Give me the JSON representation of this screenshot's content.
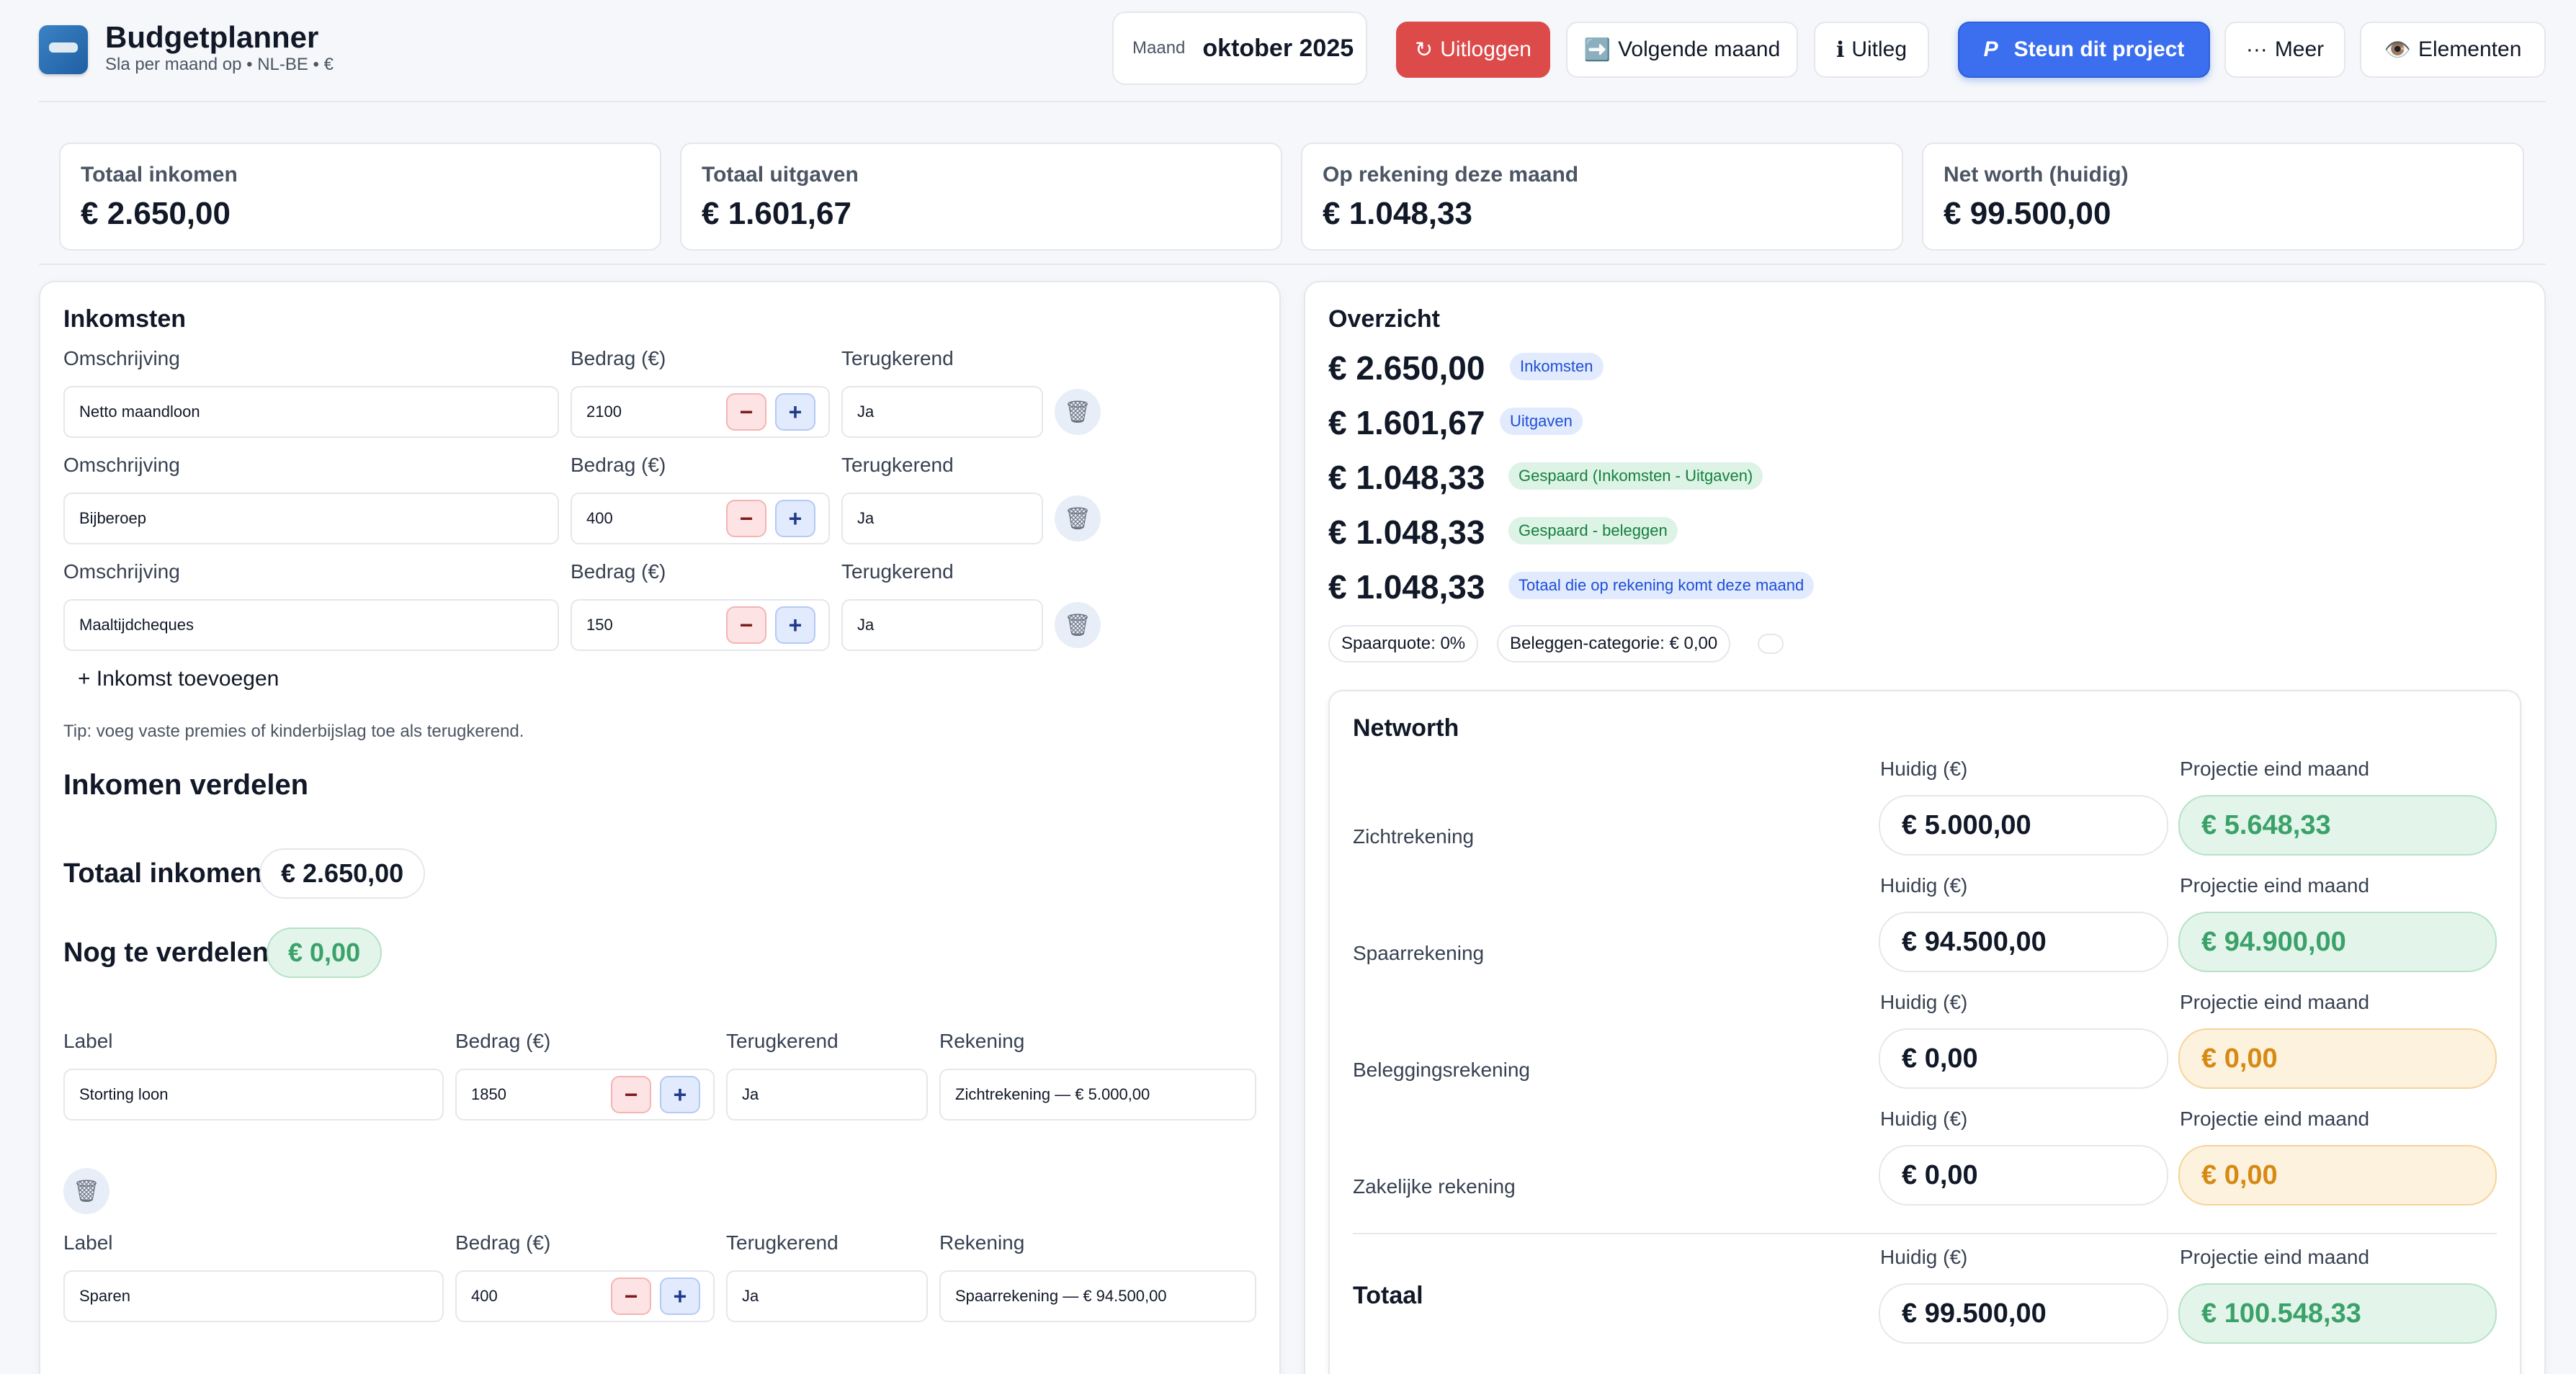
{
  "header": {
    "app_title": "Budgetplanner",
    "app_subtitle": "Sla per maand op • NL-BE • €",
    "month_label": "Maand",
    "month_value": "oktober 2025",
    "logout_label": "Uitloggen",
    "logout_icon": "↻",
    "next_month_label": "Volgende maand",
    "next_month_icon": "➡️",
    "info_label": "Uitleg",
    "info_icon": "ℹ",
    "support_label": "Steun dit project",
    "support_icon": "P",
    "more_label": "Meer",
    "more_icon": "···",
    "elements_label": "Elementen",
    "elements_icon": "👁️",
    "colors": {
      "logout": "#dc4a4a",
      "support": "#3b6ff0"
    }
  },
  "stats": [
    {
      "label": "Totaal inkomen",
      "value": "€ 2.650,00"
    },
    {
      "label": "Totaal uitgaven",
      "value": "€ 1.601,67"
    },
    {
      "label": "Op rekening deze maand",
      "value": "€ 1.048,33"
    },
    {
      "label": "Net worth (huidig)",
      "value": "€ 99.500,00"
    }
  ],
  "income": {
    "title": "Inkomsten",
    "col_description": "Omschrijving",
    "col_amount": "Bedrag (€)",
    "col_recurring": "Terugkerend",
    "rows": [
      {
        "description": "Netto maandloon",
        "amount": "2100",
        "recurring": "Ja"
      },
      {
        "description": "Bijberoep",
        "amount": "400",
        "recurring": "Ja"
      },
      {
        "description": "Maaltijdcheques",
        "amount": "150",
        "recurring": "Ja"
      }
    ],
    "add_label": "+ Inkomst toevoegen",
    "tip": "Tip: voeg vaste premies of kinderbijslag toe als terugkerend."
  },
  "distribute": {
    "title": "Inkomen verdelen",
    "total_label": "Totaal inkomen",
    "total_value": "€ 2.650,00",
    "remaining_label": "Nog te verdelen",
    "remaining_value": "€ 0,00",
    "col_label": "Label",
    "col_amount": "Bedrag (€)",
    "col_recurring": "Terugkerend",
    "col_account": "Rekening",
    "rows": [
      {
        "label": "Storting loon",
        "amount": "1850",
        "recurring": "Ja",
        "account": "Zichtrekening — € 5.000,00"
      },
      {
        "label": "Sparen",
        "amount": "400",
        "recurring": "Ja",
        "account": "Spaarrekening — € 94.500,00"
      }
    ]
  },
  "overview": {
    "title": "Overzicht",
    "items": [
      {
        "amount": "€ 2.650,00",
        "tag": "Inkomsten",
        "tone": "blue"
      },
      {
        "amount": "€ 1.601,67",
        "tag": "Uitgaven",
        "tone": "blue"
      },
      {
        "amount": "€ 1.048,33",
        "tag": "Gespaard (Inkomsten - Uitgaven)",
        "tone": "green"
      },
      {
        "amount": "€ 1.048,33",
        "tag": "Gespaard - beleggen",
        "tone": "green"
      },
      {
        "amount": "€ 1.048,33",
        "tag": "Totaal die op rekening komt deze maand",
        "tone": "blue"
      }
    ],
    "savings_rate": "Spaarquote: 0%",
    "invest_category": "Beleggen-categorie: € 0,00"
  },
  "networth": {
    "title": "Networth",
    "col_current": "Huidig (€)",
    "col_projection": "Projectie eind maand",
    "accounts": [
      {
        "name": "Zichtrekening",
        "current": "€ 5.000,00",
        "projection": "€ 5.648,33",
        "tone": "green"
      },
      {
        "name": "Spaarrekening",
        "current": "€ 94.500,00",
        "projection": "€ 94.900,00",
        "tone": "green"
      },
      {
        "name": "Beleggingsrekening",
        "current": "€ 0,00",
        "projection": "€ 0,00",
        "tone": "orange"
      },
      {
        "name": "Zakelijke rekening",
        "current": "€ 0,00",
        "projection": "€ 0,00",
        "tone": "orange"
      }
    ],
    "total_label": "Totaal",
    "total_current": "€ 99.500,00",
    "total_projection": "€ 100.548,33"
  },
  "icons": {
    "trash": "trash-icon",
    "minus": "minus-icon",
    "plus": "plus-icon",
    "logo": "app-logo-icon"
  }
}
